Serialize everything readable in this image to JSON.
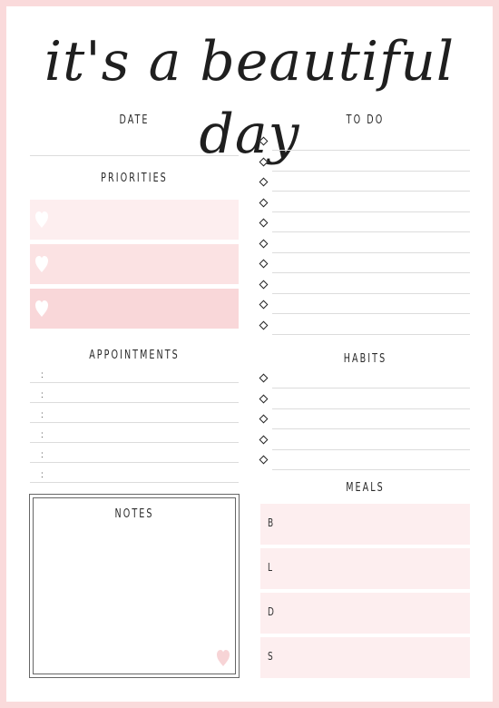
{
  "title": "it's a beautiful day",
  "colors": {
    "border": "#fadadb",
    "priority_1": "#fdeeef",
    "priority_2": "#fbe2e3",
    "priority_3": "#f9d7d9",
    "meal_bg": "#fdeeef",
    "heart": "#ffffff",
    "notes_heart": "#f7d4d6"
  },
  "left": {
    "date_label": "DATE",
    "priorities_label": "PRIORITIES",
    "priorities": [
      {
        "icon": "heart-icon"
      },
      {
        "icon": "heart-icon"
      },
      {
        "icon": "heart-icon"
      }
    ],
    "appointments_label": "APPOINTMENTS",
    "appointments": [
      {
        "sep": ":"
      },
      {
        "sep": ":"
      },
      {
        "sep": ":"
      },
      {
        "sep": ":"
      },
      {
        "sep": ":"
      },
      {
        "sep": ":"
      }
    ],
    "notes_label": "NOTES"
  },
  "right": {
    "todo_label": "TO DO",
    "todo_count": 10,
    "habits_label": "HABITS",
    "habits_count": 5,
    "meals_label": "MEALS",
    "meals": [
      "B",
      "L",
      "D",
      "S"
    ]
  }
}
